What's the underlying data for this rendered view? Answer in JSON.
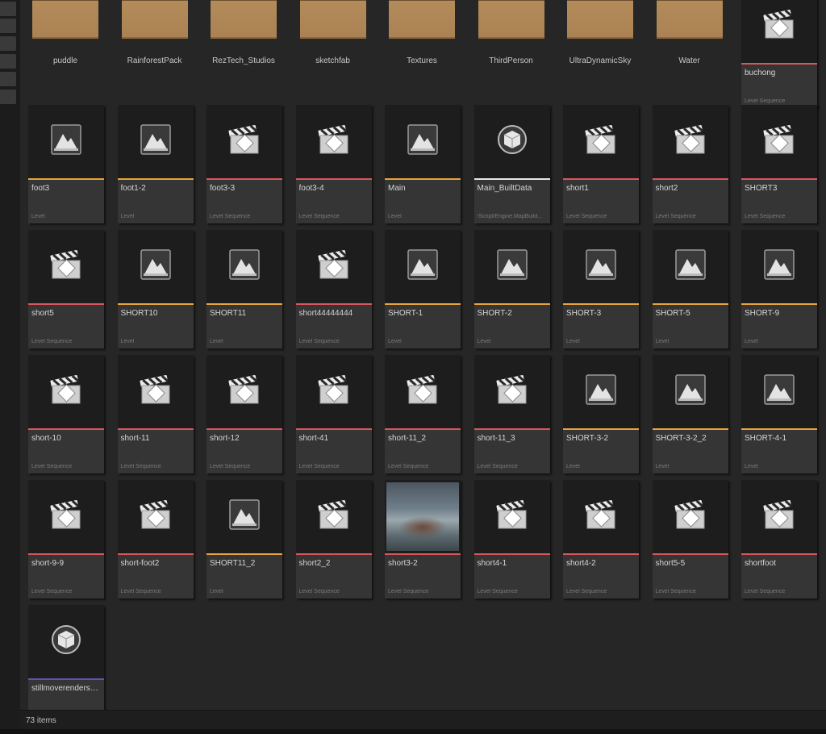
{
  "colors": {
    "level": "#e8a33b",
    "level_sequence": "#d9575b",
    "map_build_data": "#e6e6e6",
    "movie_render_settings": "#6a4fb3"
  },
  "folders": [
    {
      "label": "puddle"
    },
    {
      "label": "RainforestPack"
    },
    {
      "label": "RezTech_Studios"
    },
    {
      "label": "sketchfab"
    },
    {
      "label": "Textures"
    },
    {
      "label": "ThirdPerson"
    },
    {
      "label": "UltraDynamicSky"
    },
    {
      "label": "Water"
    }
  ],
  "assets": [
    {
      "name": "buchong",
      "type": "Level Sequence",
      "icon": "clapperboard-icon"
    },
    {
      "name": "foot3",
      "type": "Level",
      "icon": "level-icon"
    },
    {
      "name": "foot1-2",
      "type": "Level",
      "icon": "level-icon"
    },
    {
      "name": "foot3-3",
      "type": "Level Sequence",
      "icon": "clapperboard-icon"
    },
    {
      "name": "foot3-4",
      "type": "Level Sequence",
      "icon": "clapperboard-icon"
    },
    {
      "name": "Main",
      "type": "Level",
      "icon": "level-icon"
    },
    {
      "name": "Main_BuiltData",
      "type": "/Script/Engine.MapBuild...",
      "icon": "cube-icon"
    },
    {
      "name": "short1",
      "type": "Level Sequence",
      "icon": "clapperboard-icon"
    },
    {
      "name": "short2",
      "type": "Level Sequence",
      "icon": "clapperboard-icon"
    },
    {
      "name": "SHORT3",
      "type": "Level Sequence",
      "icon": "clapperboard-icon"
    },
    {
      "name": "short5",
      "type": "Level Sequence",
      "icon": "clapperboard-icon"
    },
    {
      "name": "SHORT10",
      "type": "Level",
      "icon": "level-icon"
    },
    {
      "name": "SHORT11",
      "type": "Level",
      "icon": "level-icon"
    },
    {
      "name": "short44444444",
      "type": "Level Sequence",
      "icon": "clapperboard-icon"
    },
    {
      "name": "SHORT-1",
      "type": "Level",
      "icon": "level-icon"
    },
    {
      "name": "SHORT-2",
      "type": "Level",
      "icon": "level-icon"
    },
    {
      "name": "SHORT-3",
      "type": "Level",
      "icon": "level-icon"
    },
    {
      "name": "SHORT-5",
      "type": "Level",
      "icon": "level-icon"
    },
    {
      "name": "SHORT-9",
      "type": "Level",
      "icon": "level-icon"
    },
    {
      "name": "short-10",
      "type": "Level Sequence",
      "icon": "clapperboard-icon"
    },
    {
      "name": "short-11",
      "type": "Level Sequence",
      "icon": "clapperboard-icon"
    },
    {
      "name": "short-12",
      "type": "Level Sequence",
      "icon": "clapperboard-icon"
    },
    {
      "name": "short-41",
      "type": "Level Sequence",
      "icon": "clapperboard-icon"
    },
    {
      "name": "short-11_2",
      "type": "Level Sequence",
      "icon": "clapperboard-icon"
    },
    {
      "name": "short-11_3",
      "type": "Level Sequence",
      "icon": "clapperboard-icon"
    },
    {
      "name": "SHORT-3-2",
      "type": "Level",
      "icon": "level-icon"
    },
    {
      "name": "SHORT-3-2_2",
      "type": "Level",
      "icon": "level-icon"
    },
    {
      "name": "SHORT-4-1",
      "type": "Level",
      "icon": "level-icon"
    },
    {
      "name": "short-9-9",
      "type": "Level Sequence",
      "icon": "clapperboard-icon"
    },
    {
      "name": "short-foot2",
      "type": "Level Sequence",
      "icon": "clapperboard-icon"
    },
    {
      "name": "SHORT11_2",
      "type": "Level",
      "icon": "level-icon"
    },
    {
      "name": "short2_2",
      "type": "Level Sequence",
      "icon": "clapperboard-icon"
    },
    {
      "name": "short3-2",
      "type": "Level Sequence",
      "icon": "thumbnail-photo"
    },
    {
      "name": "short4-1",
      "type": "Level Sequence",
      "icon": "clapperboard-icon"
    },
    {
      "name": "short4-2",
      "type": "Level Sequence",
      "icon": "clapperboard-icon"
    },
    {
      "name": "short5-5",
      "type": "Level Sequence",
      "icon": "clapperboard-icon"
    },
    {
      "name": "shortfoot",
      "type": "Level Sequence",
      "icon": "clapperboard-icon"
    },
    {
      "name": "stillmoverenderset...",
      "type": "",
      "icon": "cube-icon"
    }
  ],
  "status": {
    "item_count": "73 items"
  }
}
